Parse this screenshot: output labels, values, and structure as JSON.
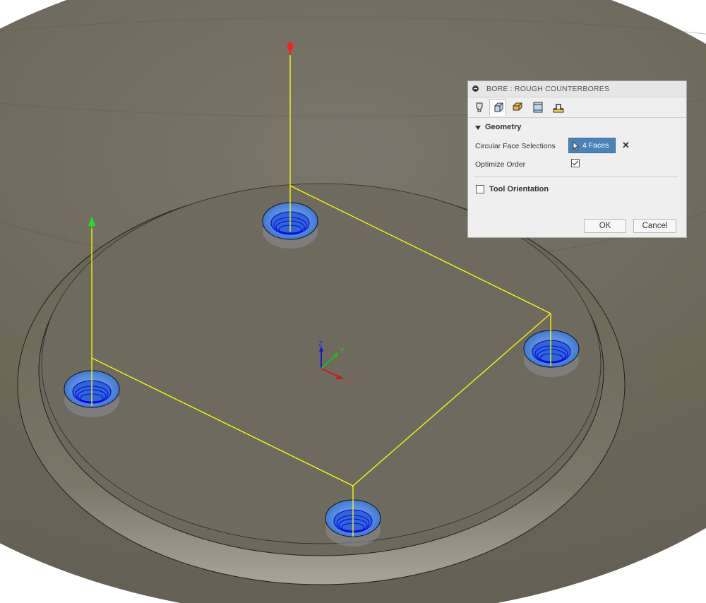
{
  "viewport": {
    "axis_labels": {
      "z": "Z",
      "y": "Y",
      "x": "X"
    }
  },
  "dialog": {
    "title": "BORE : ROUGH COUNTERBORES",
    "tabs": [
      {
        "icon": "tool-icon",
        "active": false
      },
      {
        "icon": "geometry-icon",
        "active": true
      },
      {
        "icon": "heights-icon",
        "active": false
      },
      {
        "icon": "passes-icon",
        "active": false
      },
      {
        "icon": "linking-icon",
        "active": false
      }
    ],
    "geometry": {
      "section_label": "Geometry",
      "circular_face_label": "Circular Face Selections",
      "selection_button": "4 Faces",
      "optimize_label": "Optimize Order",
      "optimize_checked": true
    },
    "tool_orientation": {
      "label": "Tool Orientation",
      "checked": false
    },
    "buttons": {
      "ok": "OK",
      "cancel": "Cancel"
    }
  },
  "colors": {
    "toolpath": "#ffff00",
    "selection_blue": "#4a83b6",
    "start_marker": "#ff0000",
    "end_marker": "#00cc00"
  }
}
